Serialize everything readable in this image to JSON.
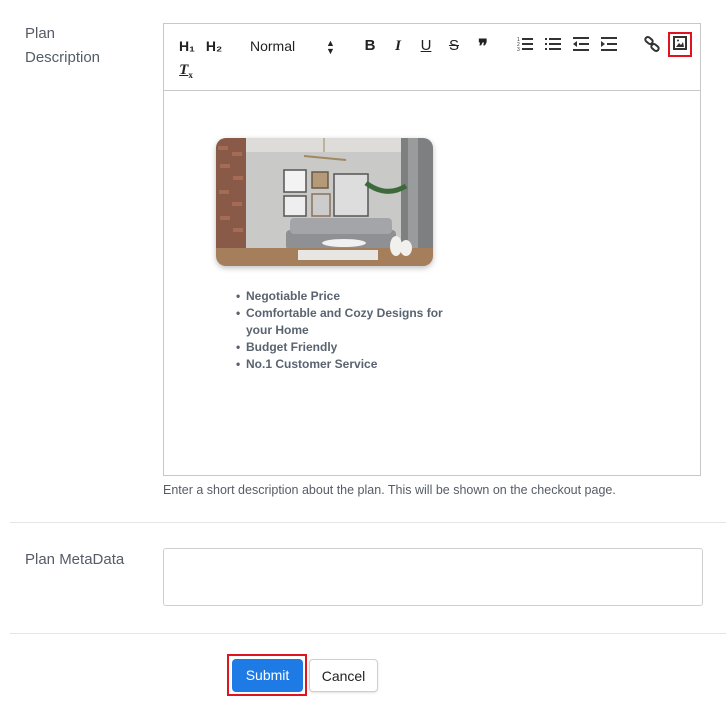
{
  "description_field": {
    "label": "Plan\nDescription",
    "label_line1": "Plan",
    "label_line2": "Description",
    "toolbar": {
      "h1": "H₁",
      "h2": "H₂",
      "format_select": "Normal",
      "bold": "B",
      "italic": "I",
      "underline": "U",
      "strike": "S",
      "quote": "❞",
      "clear_format": "Tx",
      "icons": [
        "header-1-icon",
        "header-2-icon",
        "bold-icon",
        "italic-icon",
        "underline-icon",
        "strikethrough-icon",
        "blockquote-icon",
        "ordered-list-icon",
        "bullet-list-icon",
        "outdent-icon",
        "indent-icon",
        "link-icon",
        "image-icon",
        "clear-format-icon"
      ]
    },
    "content": {
      "image_alt": "Living room interior with grey sofa, framed art and brick wall",
      "bullets": [
        "Negotiable Price",
        "Comfortable and Cozy Designs for your Home",
        "Budget Friendly",
        "No.1 Customer Service"
      ]
    },
    "help_text": "Enter a short description about the plan. This will be shown on the checkout page."
  },
  "metadata_field": {
    "label": "Plan MetaData",
    "value": ""
  },
  "actions": {
    "submit_label": "Submit",
    "cancel_label": "Cancel"
  },
  "colors": {
    "primary": "#1e7ae4",
    "highlight": "#e0141e"
  }
}
